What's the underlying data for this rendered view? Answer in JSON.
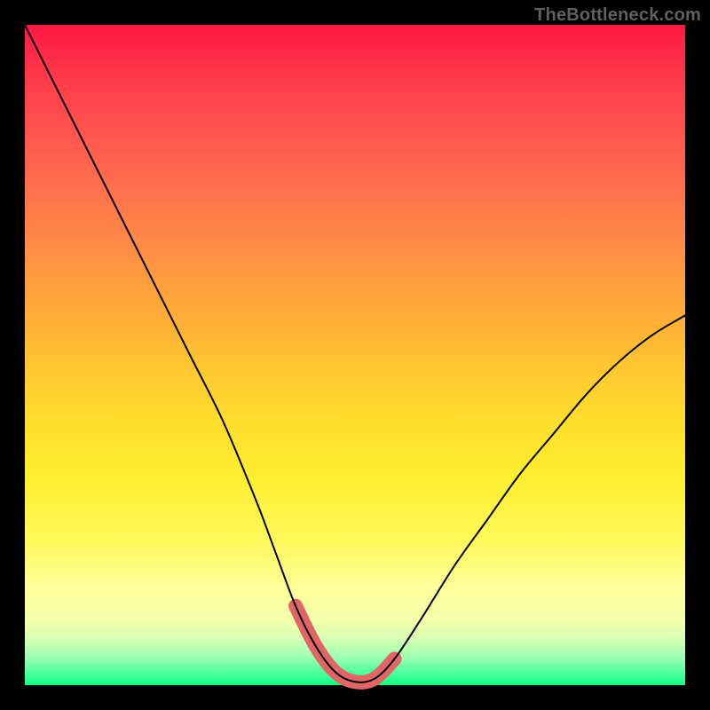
{
  "watermark": "TheBottleneck.com",
  "chart_data": {
    "type": "line",
    "title": "",
    "xlabel": "",
    "ylabel": "",
    "xlim": [
      0,
      100
    ],
    "ylim": [
      0,
      100
    ],
    "series": [
      {
        "name": "bottleneck-curve",
        "color": "#000000",
        "x": [
          0,
          5,
          10,
          15,
          20,
          25,
          30,
          35,
          38,
          41,
          44,
          47,
          50,
          53,
          56,
          60,
          65,
          70,
          75,
          80,
          85,
          90,
          95,
          100
        ],
        "y": [
          100,
          90,
          80,
          70,
          60,
          50,
          40,
          28,
          20,
          12,
          6,
          2,
          0.5,
          1,
          4,
          10,
          18,
          25,
          32,
          38,
          44,
          49,
          53,
          56
        ]
      },
      {
        "name": "highlight-band",
        "color": "#e06666",
        "x": [
          41,
          44,
          47,
          50,
          53,
          56
        ],
        "y": [
          12,
          6,
          2,
          0.5,
          1,
          4
        ]
      }
    ],
    "background_gradient": {
      "stops": [
        {
          "pos": 0.0,
          "hex": "#ff1744"
        },
        {
          "pos": 0.18,
          "hex": "#ff5a50"
        },
        {
          "pos": 0.38,
          "hex": "#ff9a40"
        },
        {
          "pos": 0.58,
          "hex": "#ffd92e"
        },
        {
          "pos": 0.78,
          "hex": "#fff95a"
        },
        {
          "pos": 0.93,
          "hex": "#d8ffb4"
        },
        {
          "pos": 1.0,
          "hex": "#13ff7e"
        }
      ]
    }
  }
}
